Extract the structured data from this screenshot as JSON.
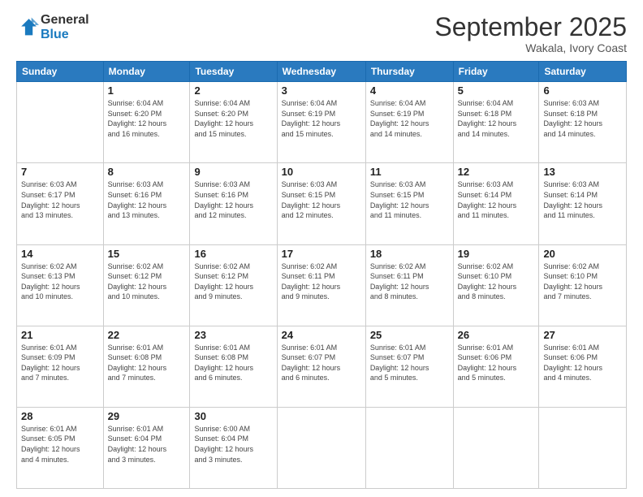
{
  "logo": {
    "general": "General",
    "blue": "Blue"
  },
  "title": "September 2025",
  "subtitle": "Wakala, Ivory Coast",
  "days_of_week": [
    "Sunday",
    "Monday",
    "Tuesday",
    "Wednesday",
    "Thursday",
    "Friday",
    "Saturday"
  ],
  "weeks": [
    [
      {
        "day": "",
        "info": ""
      },
      {
        "day": "1",
        "info": "Sunrise: 6:04 AM\nSunset: 6:20 PM\nDaylight: 12 hours\nand 16 minutes."
      },
      {
        "day": "2",
        "info": "Sunrise: 6:04 AM\nSunset: 6:20 PM\nDaylight: 12 hours\nand 15 minutes."
      },
      {
        "day": "3",
        "info": "Sunrise: 6:04 AM\nSunset: 6:19 PM\nDaylight: 12 hours\nand 15 minutes."
      },
      {
        "day": "4",
        "info": "Sunrise: 6:04 AM\nSunset: 6:19 PM\nDaylight: 12 hours\nand 14 minutes."
      },
      {
        "day": "5",
        "info": "Sunrise: 6:04 AM\nSunset: 6:18 PM\nDaylight: 12 hours\nand 14 minutes."
      },
      {
        "day": "6",
        "info": "Sunrise: 6:03 AM\nSunset: 6:18 PM\nDaylight: 12 hours\nand 14 minutes."
      }
    ],
    [
      {
        "day": "7",
        "info": "Sunrise: 6:03 AM\nSunset: 6:17 PM\nDaylight: 12 hours\nand 13 minutes."
      },
      {
        "day": "8",
        "info": "Sunrise: 6:03 AM\nSunset: 6:16 PM\nDaylight: 12 hours\nand 13 minutes."
      },
      {
        "day": "9",
        "info": "Sunrise: 6:03 AM\nSunset: 6:16 PM\nDaylight: 12 hours\nand 12 minutes."
      },
      {
        "day": "10",
        "info": "Sunrise: 6:03 AM\nSunset: 6:15 PM\nDaylight: 12 hours\nand 12 minutes."
      },
      {
        "day": "11",
        "info": "Sunrise: 6:03 AM\nSunset: 6:15 PM\nDaylight: 12 hours\nand 11 minutes."
      },
      {
        "day": "12",
        "info": "Sunrise: 6:03 AM\nSunset: 6:14 PM\nDaylight: 12 hours\nand 11 minutes."
      },
      {
        "day": "13",
        "info": "Sunrise: 6:03 AM\nSunset: 6:14 PM\nDaylight: 12 hours\nand 11 minutes."
      }
    ],
    [
      {
        "day": "14",
        "info": "Sunrise: 6:02 AM\nSunset: 6:13 PM\nDaylight: 12 hours\nand 10 minutes."
      },
      {
        "day": "15",
        "info": "Sunrise: 6:02 AM\nSunset: 6:12 PM\nDaylight: 12 hours\nand 10 minutes."
      },
      {
        "day": "16",
        "info": "Sunrise: 6:02 AM\nSunset: 6:12 PM\nDaylight: 12 hours\nand 9 minutes."
      },
      {
        "day": "17",
        "info": "Sunrise: 6:02 AM\nSunset: 6:11 PM\nDaylight: 12 hours\nand 9 minutes."
      },
      {
        "day": "18",
        "info": "Sunrise: 6:02 AM\nSunset: 6:11 PM\nDaylight: 12 hours\nand 8 minutes."
      },
      {
        "day": "19",
        "info": "Sunrise: 6:02 AM\nSunset: 6:10 PM\nDaylight: 12 hours\nand 8 minutes."
      },
      {
        "day": "20",
        "info": "Sunrise: 6:02 AM\nSunset: 6:10 PM\nDaylight: 12 hours\nand 7 minutes."
      }
    ],
    [
      {
        "day": "21",
        "info": "Sunrise: 6:01 AM\nSunset: 6:09 PM\nDaylight: 12 hours\nand 7 minutes."
      },
      {
        "day": "22",
        "info": "Sunrise: 6:01 AM\nSunset: 6:08 PM\nDaylight: 12 hours\nand 7 minutes."
      },
      {
        "day": "23",
        "info": "Sunrise: 6:01 AM\nSunset: 6:08 PM\nDaylight: 12 hours\nand 6 minutes."
      },
      {
        "day": "24",
        "info": "Sunrise: 6:01 AM\nSunset: 6:07 PM\nDaylight: 12 hours\nand 6 minutes."
      },
      {
        "day": "25",
        "info": "Sunrise: 6:01 AM\nSunset: 6:07 PM\nDaylight: 12 hours\nand 5 minutes."
      },
      {
        "day": "26",
        "info": "Sunrise: 6:01 AM\nSunset: 6:06 PM\nDaylight: 12 hours\nand 5 minutes."
      },
      {
        "day": "27",
        "info": "Sunrise: 6:01 AM\nSunset: 6:06 PM\nDaylight: 12 hours\nand 4 minutes."
      }
    ],
    [
      {
        "day": "28",
        "info": "Sunrise: 6:01 AM\nSunset: 6:05 PM\nDaylight: 12 hours\nand 4 minutes."
      },
      {
        "day": "29",
        "info": "Sunrise: 6:01 AM\nSunset: 6:04 PM\nDaylight: 12 hours\nand 3 minutes."
      },
      {
        "day": "30",
        "info": "Sunrise: 6:00 AM\nSunset: 6:04 PM\nDaylight: 12 hours\nand 3 minutes."
      },
      {
        "day": "",
        "info": ""
      },
      {
        "day": "",
        "info": ""
      },
      {
        "day": "",
        "info": ""
      },
      {
        "day": "",
        "info": ""
      }
    ]
  ]
}
